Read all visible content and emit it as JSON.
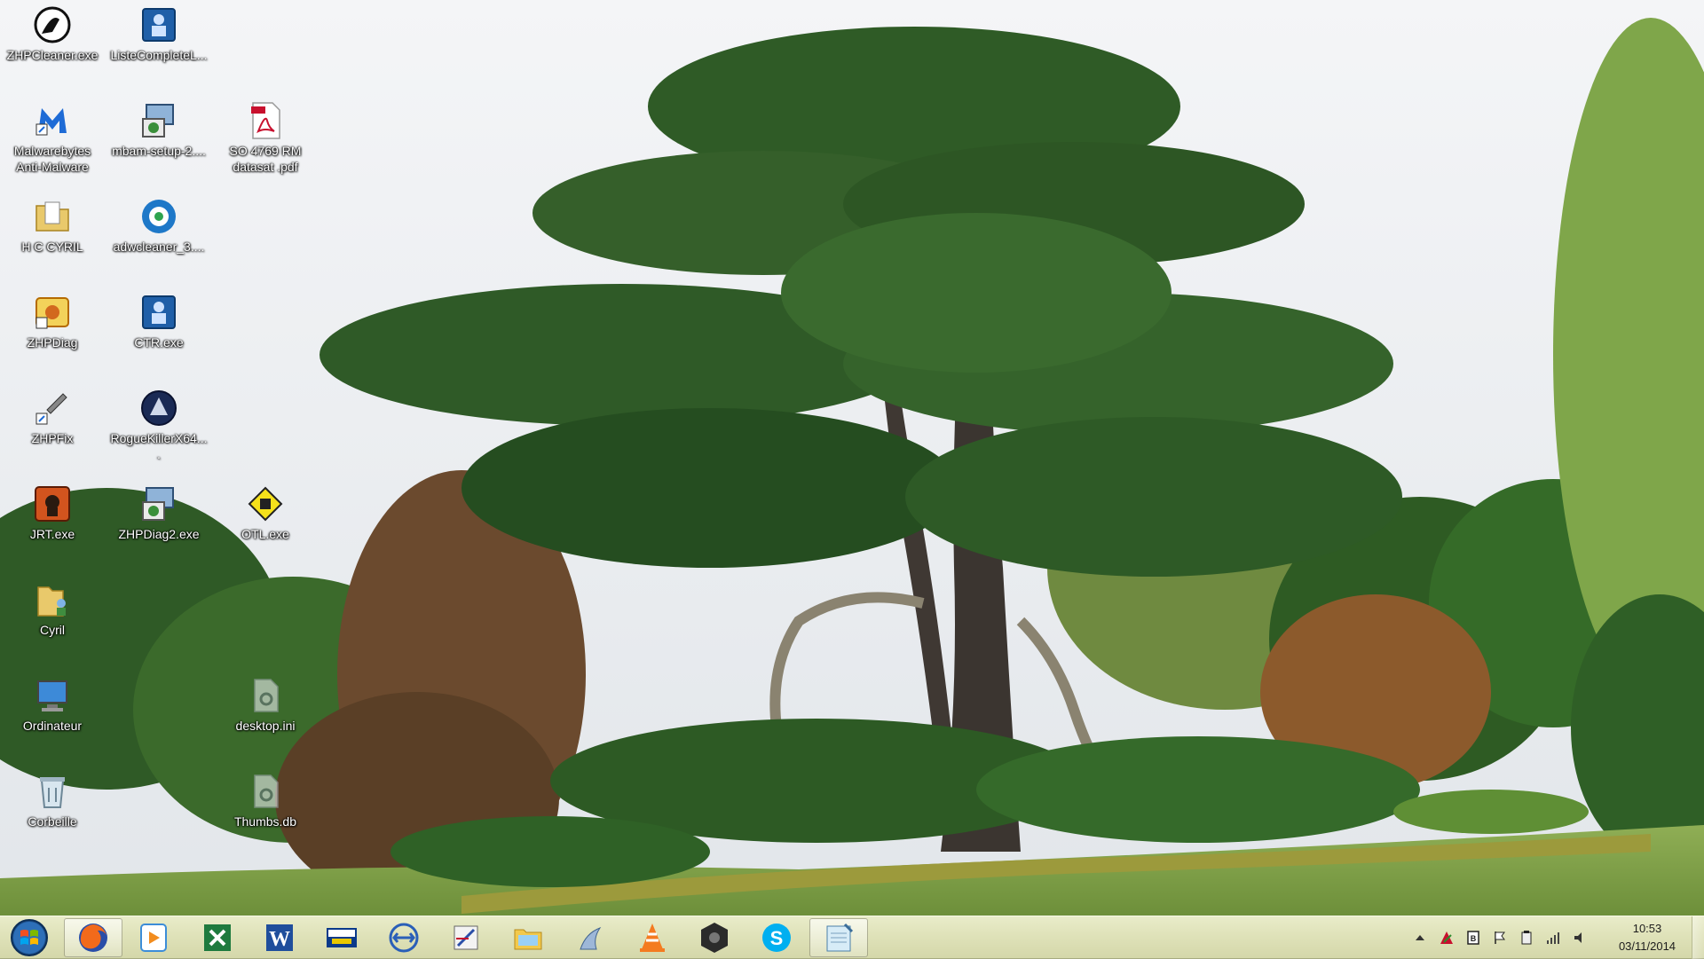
{
  "desktop": {
    "icons": [
      {
        "label": "ZHPCleaner.exe",
        "icon": "zhpcleaner-icon"
      },
      {
        "label": "ListeCompleteL...",
        "icon": "listecomplete-icon"
      },
      {
        "label": "Malwarebytes\nAnti-Malware",
        "icon": "malwarebytes-icon"
      },
      {
        "label": "mbam-setup-2....",
        "icon": "installer-icon"
      },
      {
        "label": "SO 4769 RM\ndatasat .pdf",
        "icon": "pdf-icon"
      },
      {
        "label": "H C CYRIL",
        "icon": "folder-doc-icon"
      },
      {
        "label": "adwcleaner_3....",
        "icon": "adwcleaner-icon"
      },
      {
        "label": "ZHPDiag",
        "icon": "zhpdiag-icon"
      },
      {
        "label": "CTR.exe",
        "icon": "ctr-icon"
      },
      {
        "label": "ZHPFix",
        "icon": "zhpfix-icon"
      },
      {
        "label": "RogueKillerX64....",
        "icon": "roguekiller-icon"
      },
      {
        "label": "JRT.exe",
        "icon": "jrt-icon"
      },
      {
        "label": "ZHPDiag2.exe",
        "icon": "installer-icon"
      },
      {
        "label": "OTL.exe",
        "icon": "otl-icon"
      },
      {
        "label": "Cyril",
        "icon": "user-folder-icon"
      },
      {
        "label": "Ordinateur",
        "icon": "computer-icon"
      },
      {
        "label": "desktop.ini",
        "icon": "settings-file-icon"
      },
      {
        "label": "Corbeille",
        "icon": "recycle-bin-icon"
      },
      {
        "label": "Thumbs.db",
        "icon": "settings-file-icon"
      }
    ]
  },
  "taskbar": {
    "start": "start-orb-icon",
    "pinned": [
      {
        "icon": "firefox-icon",
        "active": true
      },
      {
        "icon": "media-player-icon",
        "active": false
      },
      {
        "icon": "excel-icon",
        "active": false
      },
      {
        "icon": "word-icon",
        "active": false
      },
      {
        "icon": "lcl-bank-icon",
        "active": false
      },
      {
        "icon": "teamviewer-icon",
        "active": false
      },
      {
        "icon": "editor-pen-icon",
        "active": false
      },
      {
        "icon": "file-explorer-icon",
        "active": false
      },
      {
        "icon": "wireless-icon",
        "active": false
      },
      {
        "icon": "vlc-icon",
        "active": false
      },
      {
        "icon": "camera-lens-icon",
        "active": false
      },
      {
        "icon": "skype-icon",
        "active": false
      },
      {
        "icon": "notepad-icon",
        "active": true
      }
    ],
    "tray": [
      "show-hidden-icons-icon",
      "security-icon",
      "battery-icon",
      "flag-icon",
      "device-icon",
      "signal-icon",
      "volume-icon"
    ],
    "clock": {
      "time": "10:53",
      "date": "03/11/2014"
    }
  }
}
